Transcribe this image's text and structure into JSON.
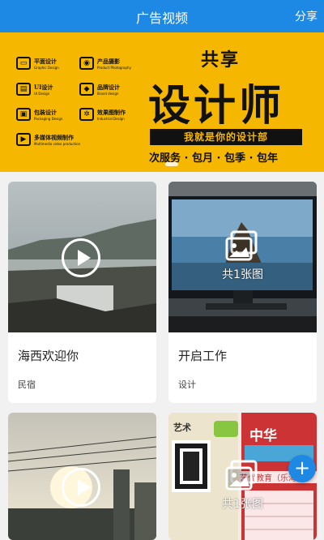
{
  "header": {
    "title": "广告视频",
    "share": "分享"
  },
  "banner": {
    "headline_top": "共享",
    "headline_main": "设计师",
    "tagline": "我就是你的设计部",
    "plans": "次服务 · 包月 · 包季 · 包年",
    "services": [
      {
        "label": "平面设计",
        "sub": "Graphic Design",
        "icon": "picture-icon"
      },
      {
        "label": "产品摄影",
        "sub": "Product Photography",
        "icon": "camera-icon"
      },
      {
        "label": "UI设计",
        "sub": "UI Design",
        "icon": "ui-icon"
      },
      {
        "label": "品牌设计",
        "sub": "Brand design",
        "icon": "brand-icon"
      },
      {
        "label": "包装设计",
        "sub": "Packaging Design",
        "icon": "package-icon"
      },
      {
        "label": "效果图制作",
        "sub": "Industrial Design",
        "icon": "gear-icon"
      },
      {
        "label": "多媒体视频制作",
        "sub": "Multimedia video production",
        "icon": "video-icon"
      }
    ]
  },
  "cards": [
    {
      "title": "海西欢迎你",
      "tag": "民宿",
      "type": "video"
    },
    {
      "title": "开启工作",
      "tag": "设计",
      "type": "image",
      "count_label": "共1张图"
    },
    {
      "title": "",
      "tag": "",
      "type": "video"
    },
    {
      "title": "",
      "tag": "",
      "type": "image",
      "count_label": "共1张图"
    }
  ],
  "poster": {
    "art_label": "艺术",
    "school_label": "中华",
    "promo_line": "艺优教育（乐海艺"
  },
  "fab": {
    "label": "+"
  }
}
